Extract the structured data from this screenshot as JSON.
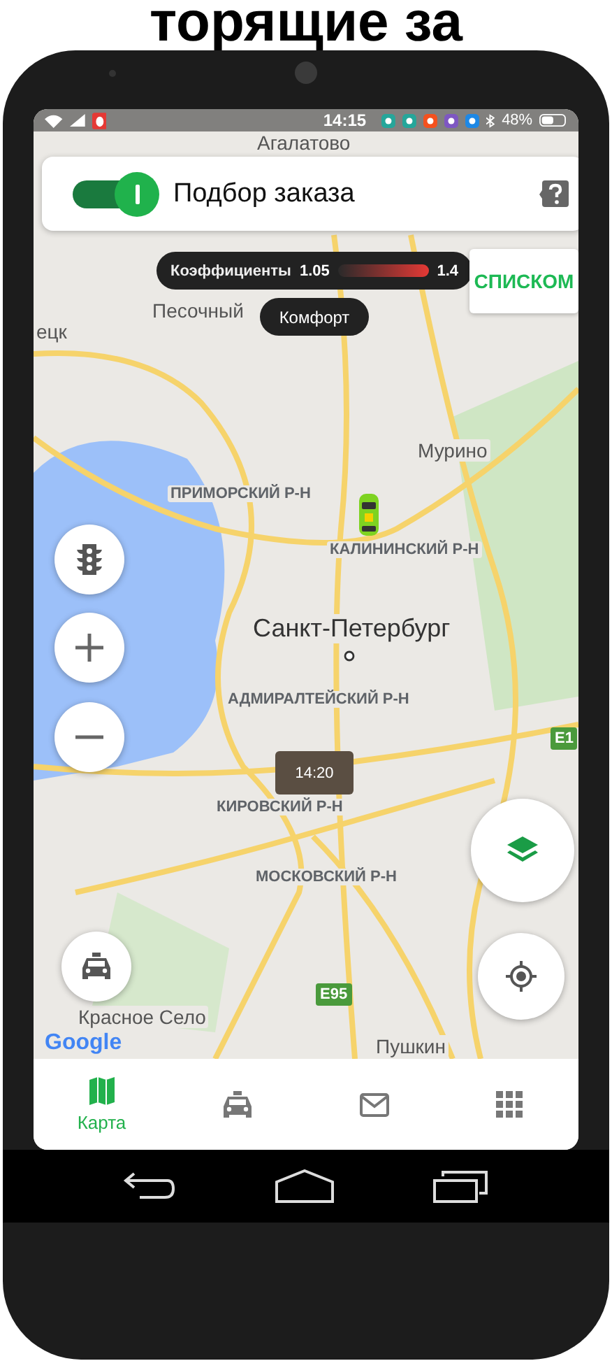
{
  "heading": "торящие за",
  "status_bar": {
    "time": "14:15",
    "battery": "48%"
  },
  "order_toggle": {
    "label": "Подбор заказа",
    "on": true
  },
  "coefficients": {
    "label": "Коэффициенты",
    "min": "1.05",
    "max": "1.4"
  },
  "list_button": "СПИСКОМ",
  "tariff": "Комфорт",
  "map": {
    "labels": [
      {
        "text": "Агалатово",
        "kind": "town"
      },
      {
        "text": "Песочный",
        "kind": "town"
      },
      {
        "text": "ецк",
        "kind": "town"
      },
      {
        "text": "Мурино",
        "kind": "town"
      },
      {
        "text": "ПРИМОРСКИЙ Р-Н",
        "kind": "district"
      },
      {
        "text": "КАЛИНИНСКИЙ Р-Н",
        "kind": "district"
      },
      {
        "text": "Санкт-Петербург",
        "kind": "city"
      },
      {
        "text": "АДМИРАЛТЕЙСКИЙ Р-Н",
        "kind": "district"
      },
      {
        "text": "КИРОВСКИЙ Р-Н",
        "kind": "district"
      },
      {
        "text": "МОСКОВСКИЙ Р-Н",
        "kind": "district"
      },
      {
        "text": "Красное Село",
        "kind": "town"
      },
      {
        "text": "Пушкин",
        "kind": "town"
      }
    ],
    "road_badges": [
      "E1",
      "E95"
    ],
    "eta_tooltip": "14:20",
    "attribution": "Google"
  },
  "bottom_nav": [
    {
      "kind": "map",
      "label": "Карта",
      "selected": true
    },
    {
      "kind": "taxi",
      "selected": false
    },
    {
      "kind": "mail",
      "selected": false
    },
    {
      "kind": "grid",
      "selected": false
    }
  ]
}
